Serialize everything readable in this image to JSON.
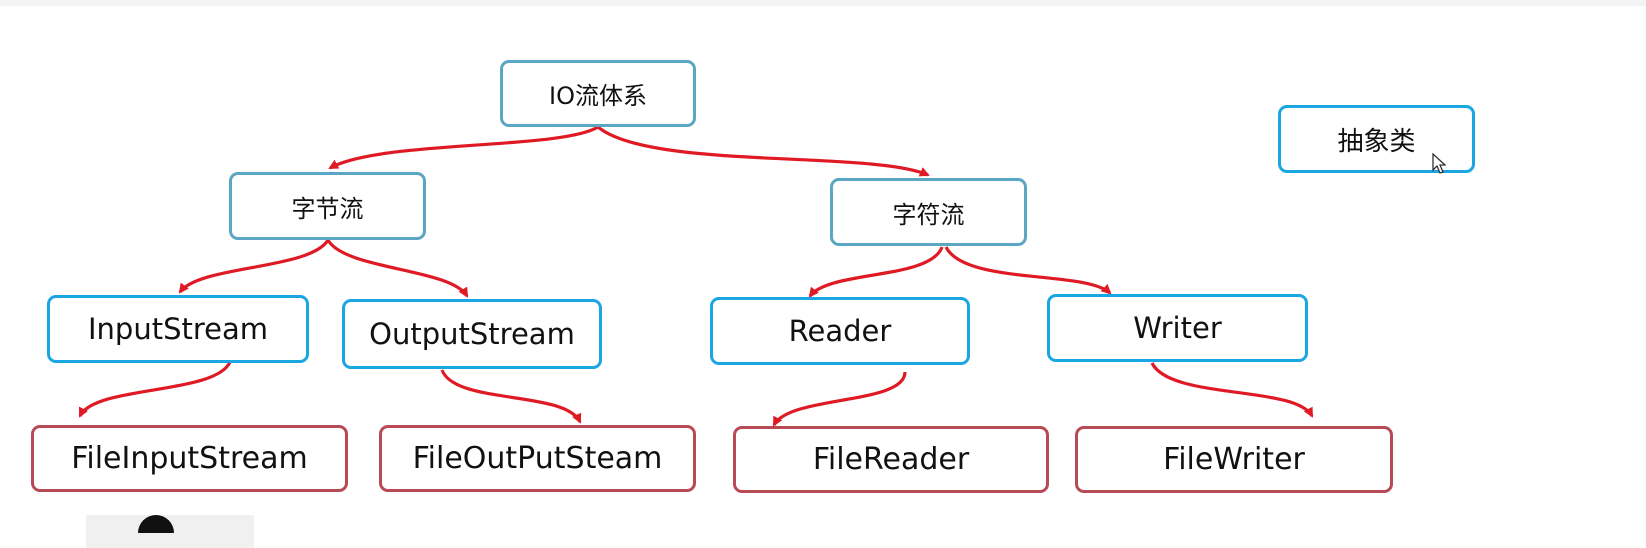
{
  "diagram": {
    "nodes": {
      "root": "IO流体系",
      "byte_stream": "字节流",
      "char_stream": "字符流",
      "input_stream": "InputStream",
      "output_stream": "OutputStream",
      "reader": "Reader",
      "writer": "Writer",
      "file_input_stream": "FileInputStream",
      "file_output_stream": "FileOutPutSteam",
      "file_reader": "FileReader",
      "file_writer": "FileWriter"
    },
    "legend": {
      "abstract_class": "抽象类"
    },
    "colors": {
      "arrow": "#e01a24",
      "category_border": "#5aa6c4",
      "abstract_border": "#1aa6e0",
      "concrete_border": "#b84a55"
    }
  }
}
